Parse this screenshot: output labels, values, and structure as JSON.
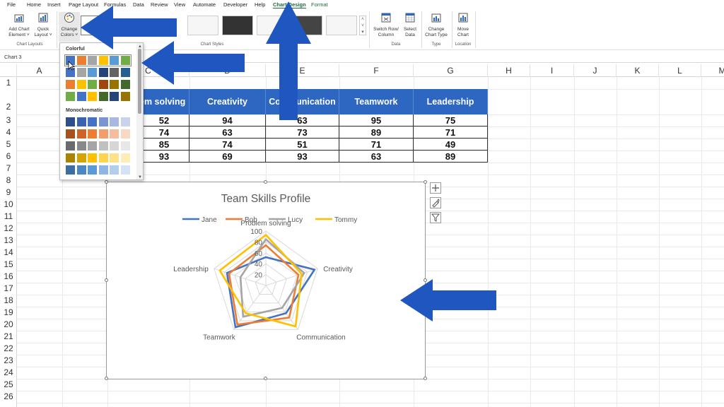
{
  "menu_tabs": [
    "File",
    "Home",
    "Insert",
    "Page Layout",
    "Formulas",
    "Data",
    "Review",
    "View",
    "Automate",
    "Developer",
    "Help",
    "Chart Design",
    "Format"
  ],
  "ribbon": {
    "add_chart_element": [
      "Add Chart",
      "Element ˅"
    ],
    "quick_layout": [
      "Quick",
      "Layout ˅"
    ],
    "change_colors": [
      "Change",
      "Colors ˅"
    ],
    "switch_row_column": [
      "Switch Row/",
      "Column"
    ],
    "select_data": [
      "Select",
      "Data"
    ],
    "change_chart_type": [
      "Change",
      "Chart Type"
    ],
    "move_chart": [
      "Move",
      "Chart"
    ],
    "groups": {
      "chart_layouts": "Chart Layouts",
      "chart_styles": "Chart Styles",
      "data": "Data",
      "type": "Type",
      "location": "Location"
    }
  },
  "name_box": "Chart 3",
  "columns": [
    "A",
    "B",
    "C",
    "D",
    "E",
    "F",
    "G",
    "H",
    "I",
    "J",
    "K",
    "L",
    "M"
  ],
  "rows": [
    "1",
    "2",
    "3",
    "4",
    "5",
    "6",
    "7",
    "8",
    "9",
    "10",
    "11",
    "12",
    "13",
    "14",
    "15",
    "16",
    "17",
    "18",
    "19",
    "20",
    "21",
    "22",
    "23",
    "24",
    "25",
    "26"
  ],
  "table": {
    "headers": [
      "em solving",
      "Creativity",
      "Communication",
      "Teamwork",
      "Leadership"
    ],
    "values": [
      [
        "52",
        "94",
        "63",
        "95",
        "75"
      ],
      [
        "74",
        "63",
        "73",
        "89",
        "71"
      ],
      [
        "85",
        "74",
        "51",
        "71",
        "49"
      ],
      [
        "93",
        "69",
        "93",
        "63",
        "89"
      ]
    ]
  },
  "dropdown": {
    "colorful_title": "Colorful",
    "monochromatic_title": "Monochromatic",
    "colorful_rows": [
      [
        "#4472c4",
        "#ed7d31",
        "#a5a5a5",
        "#ffc000",
        "#5b9bd5",
        "#70ad47"
      ],
      [
        "#4472c4",
        "#a5a5a5",
        "#5b9bd5",
        "#264478",
        "#636363",
        "#255e91"
      ],
      [
        "#ed7d31",
        "#ffc000",
        "#70ad47",
        "#9e480e",
        "#997300",
        "#43682b"
      ],
      [
        "#70ad47",
        "#4472c4",
        "#ffc000",
        "#43682b",
        "#264478",
        "#997300"
      ]
    ],
    "mono_rows": [
      [
        "#2f4e8c",
        "#3a62b0",
        "#4472c4",
        "#7b95d3",
        "#a8b8e0",
        "#c9d3ec"
      ],
      [
        "#a8511b",
        "#cf6428",
        "#ed7d31",
        "#f19e6c",
        "#f5bd9d",
        "#f9d9c4"
      ],
      [
        "#6b6b6b",
        "#898989",
        "#a5a5a5",
        "#c0c0c0",
        "#d6d6d6",
        "#e7e7e7"
      ],
      [
        "#a88400",
        "#d4a400",
        "#ffc000",
        "#ffd34d",
        "#ffe188",
        "#ffedb8"
      ],
      [
        "#3b6ea1",
        "#4a88c4",
        "#5b9bd5",
        "#8db6e2",
        "#b3cdec",
        "#d3e2f4"
      ]
    ]
  },
  "chart_data": {
    "type": "radar",
    "title": "Team Skills Profile",
    "categories": [
      "Problem solving",
      "Creativity",
      "Communication",
      "Teamwork",
      "Leadership"
    ],
    "rlim": [
      0,
      100
    ],
    "ticks": [
      "20",
      "40",
      "60",
      "80",
      "100"
    ],
    "legend": "top",
    "series": [
      {
        "name": "Jane",
        "color": "#4472c4",
        "values": [
          52,
          94,
          63,
          95,
          75
        ]
      },
      {
        "name": "Bob",
        "color": "#ed7d31",
        "values": [
          74,
          63,
          73,
          89,
          71
        ]
      },
      {
        "name": "Lucy",
        "color": "#a5a5a5",
        "values": [
          85,
          74,
          51,
          71,
          49
        ]
      },
      {
        "name": "Tommy",
        "color": "#ffc000",
        "values": [
          93,
          69,
          93,
          63,
          89
        ]
      }
    ]
  },
  "colors": {
    "accent": "#2e67c2",
    "arrow": "#1f56c0",
    "excel_green": "#1e6b3c"
  }
}
